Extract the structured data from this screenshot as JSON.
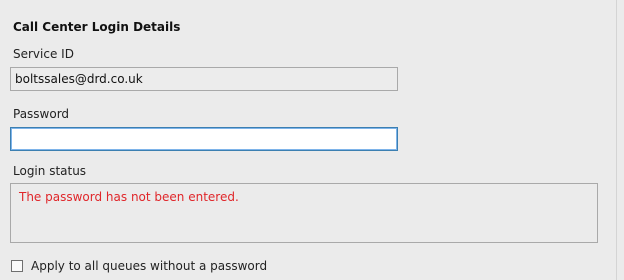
{
  "section": {
    "title": "Call Center Login Details"
  },
  "service_id": {
    "label": "Service ID",
    "value": "boltssales@drd.co.uk"
  },
  "password": {
    "label": "Password",
    "value": ""
  },
  "login_status": {
    "label": "Login status",
    "message": "The password has not been entered.",
    "message_color": "#e0262a"
  },
  "apply_all": {
    "label": "Apply to all queues without a password",
    "checked": false
  },
  "colors": {
    "background": "#ebebeb",
    "focus_border": "#3c7fb1",
    "error_text": "#e0262a"
  }
}
